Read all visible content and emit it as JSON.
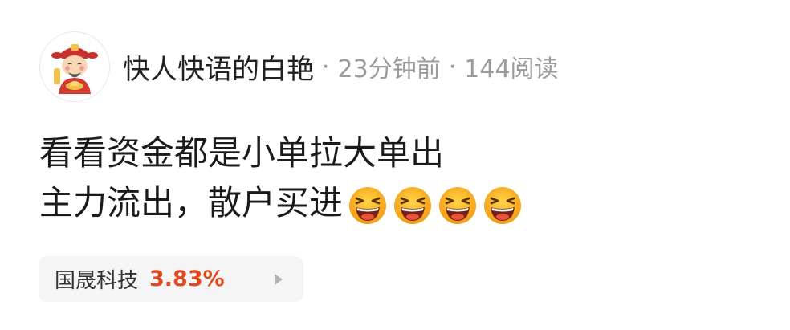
{
  "post": {
    "author": "快人快语的白艳",
    "separator": "·",
    "time_ago": "23分钟前",
    "reads": "144阅读",
    "lines": [
      "看看资金都是小单拉大单出",
      "主力流出，散户买进"
    ],
    "emoji_icon": "laughing-face-icon",
    "emoji_count": 4
  },
  "stock": {
    "name": "国晟科技",
    "change": "3.83%",
    "change_color": "#e0481f",
    "arrow_icon": "play-arrow-icon"
  },
  "colors": {
    "meta": "#9b9b9b",
    "text": "#1a1a1a",
    "chip_bg": "#f5f5f5"
  }
}
